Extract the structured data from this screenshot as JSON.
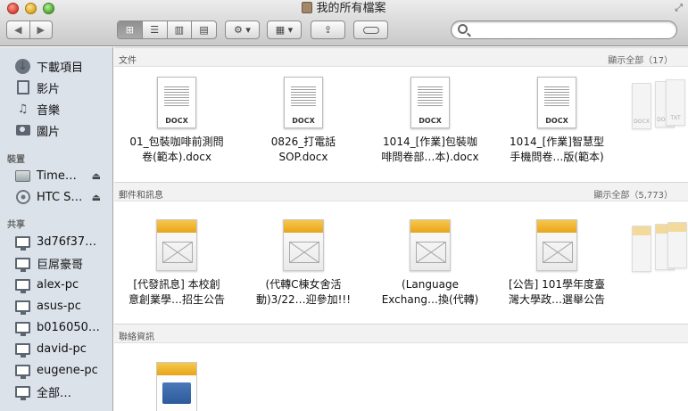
{
  "window": {
    "title": "我的所有檔案"
  },
  "toolbar": {
    "back": "◀",
    "forward": "▶",
    "view_icon": "⊞",
    "view_list": "☰",
    "view_columns": "▥",
    "view_coverflow": "▤",
    "action": "⚙ ▾",
    "arrange": "▦ ▾",
    "share": "⇪",
    "search_placeholder": ""
  },
  "sidebar": {
    "favorites": [
      {
        "label": "下載項目",
        "icon": "download-icon"
      },
      {
        "label": "影片",
        "icon": "movies-icon"
      },
      {
        "label": "音樂",
        "icon": "music-icon"
      },
      {
        "label": "圖片",
        "icon": "pictures-icon"
      }
    ],
    "devices_header": "裝置",
    "devices": [
      {
        "label": "Time…",
        "icon": "disk-icon"
      },
      {
        "label": "HTC S…",
        "icon": "disc-icon"
      }
    ],
    "shared_header": "共享",
    "shared": [
      {
        "label": "3d76f37…"
      },
      {
        "label": "巨屌豪哥"
      },
      {
        "label": "alex-pc"
      },
      {
        "label": "asus-pc"
      },
      {
        "label": "b016050…"
      },
      {
        "label": "david-pc"
      },
      {
        "label": "eugene-pc"
      },
      {
        "label": "全部…"
      }
    ]
  },
  "sections": [
    {
      "title": "文件",
      "count": "顯示全部（17）",
      "items": [
        {
          "line1": "01_包裝咖啡前測問",
          "line2": "卷(範本).docx",
          "badge": "DOCX"
        },
        {
          "line1": "0826_打電話",
          "line2": "SOP.docx",
          "badge": "DOCX"
        },
        {
          "line1": "1014_[作業]包裝咖",
          "line2": "啡問卷部…本).docx",
          "badge": "DOCX"
        },
        {
          "line1": "1014_[作業]智慧型",
          "line2": "手機問卷…版(範本)",
          "badge": "DOCX"
        }
      ],
      "ghost_labels": [
        "DOCX",
        "DOCX",
        "TXT"
      ]
    },
    {
      "title": "郵件和訊息",
      "count": "顯示全部（5,773）",
      "items": [
        {
          "line1": "[代發訊息] 本校創",
          "line2": "意創業學…招生公告"
        },
        {
          "line1": "(代轉C棟女舍活",
          "line2": "動)3/22…迎參加!!!"
        },
        {
          "line1": "(Language",
          "line2": "Exchang…換(代轉)"
        },
        {
          "line1": "[公告] 101學年度臺",
          "line2": "灣大學政…選舉公告"
        }
      ]
    },
    {
      "title": "聯絡資訊",
      "count": "",
      "items": []
    }
  ]
}
